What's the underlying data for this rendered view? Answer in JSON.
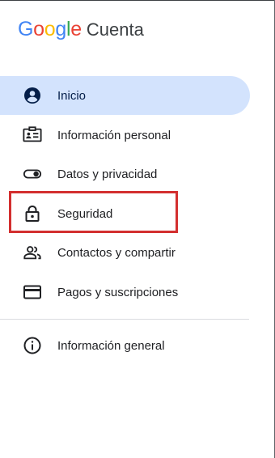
{
  "header": {
    "logo_letters": [
      "G",
      "o",
      "o",
      "g",
      "l",
      "e"
    ],
    "product_name": "Cuenta"
  },
  "colors": {
    "google_blue": "#4285F4",
    "google_red": "#EA4335",
    "google_yellow": "#FBBC05",
    "google_green": "#34A853",
    "active_background": "#d3e3fd",
    "highlight_border": "#d32f2f"
  },
  "nav": {
    "items": [
      {
        "label": "Inicio",
        "icon": "account-circle-icon",
        "active": true
      },
      {
        "label": "Información personal",
        "icon": "id-card-icon"
      },
      {
        "label": "Datos y privacidad",
        "icon": "toggle-icon"
      },
      {
        "label": "Seguridad",
        "icon": "lock-icon",
        "highlighted": true
      },
      {
        "label": "Contactos y compartir",
        "icon": "people-icon"
      },
      {
        "label": "Pagos y suscripciones",
        "icon": "credit-card-icon"
      }
    ],
    "footer_items": [
      {
        "label": "Información general",
        "icon": "info-icon"
      }
    ]
  }
}
